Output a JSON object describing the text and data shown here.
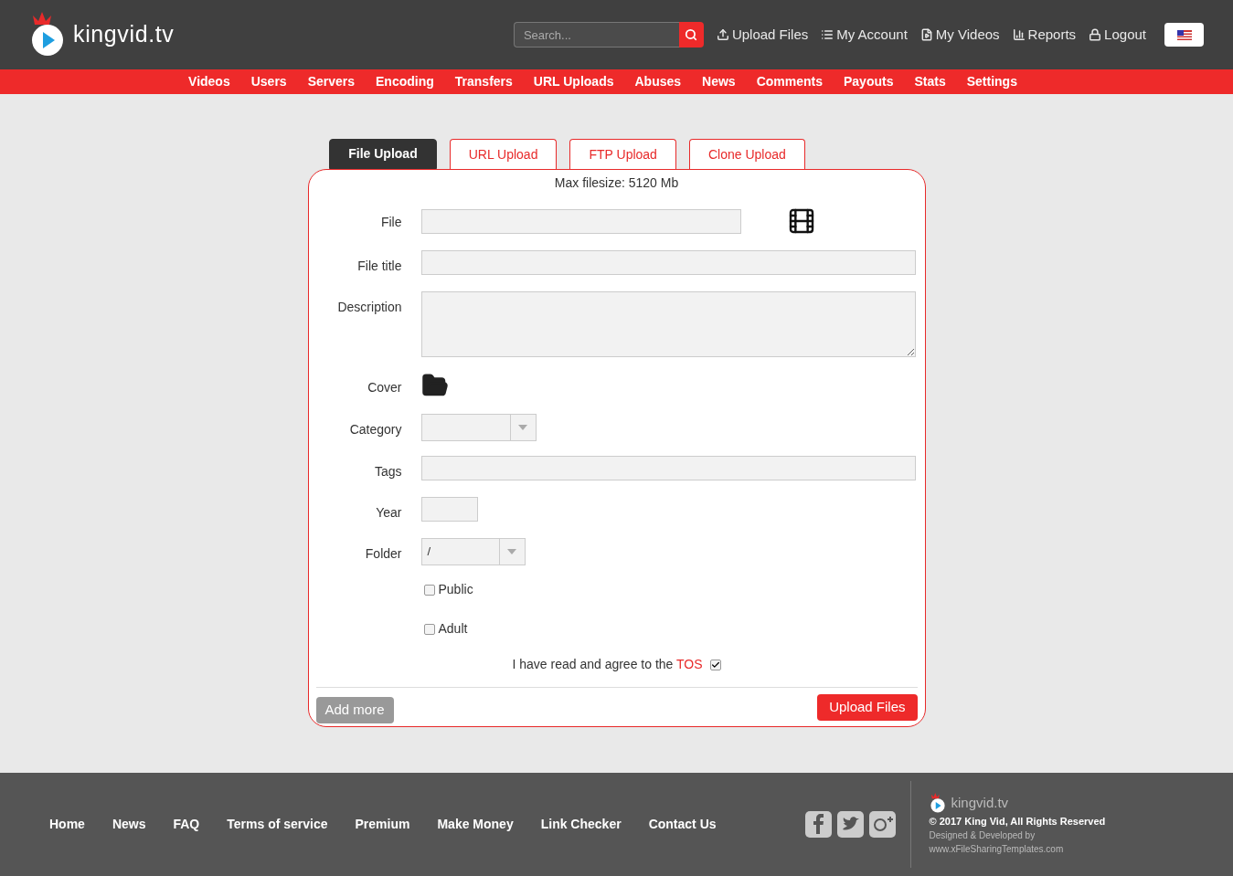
{
  "header": {
    "logo_text": "kingvid.tv",
    "search": {
      "placeholder": "Search..."
    },
    "user_menu": [
      {
        "kind": "upload",
        "label": "Upload Files"
      },
      {
        "kind": "account",
        "label": "My Account"
      },
      {
        "kind": "videos",
        "label": "My Videos"
      },
      {
        "kind": "reports",
        "label": "Reports"
      },
      {
        "kind": "logout",
        "label": "Logout"
      }
    ]
  },
  "nav": [
    "Videos",
    "Users",
    "Servers",
    "Encoding",
    "Transfers",
    "URL Uploads",
    "Abuses",
    "News",
    "Comments",
    "Payouts",
    "Stats",
    "Settings"
  ],
  "upload_tabs": [
    {
      "label": "File Upload",
      "selected": true
    },
    {
      "label": "URL Upload",
      "selected": false
    },
    {
      "label": "FTP Upload",
      "selected": false
    },
    {
      "label": "Clone Upload",
      "selected": false
    }
  ],
  "form": {
    "max_filesize": "Max filesize: 5120 Mb",
    "fields": [
      {
        "kind": "file",
        "label": "File"
      },
      {
        "kind": "text",
        "label": "File title"
      },
      {
        "kind": "textarea",
        "label": "Description"
      },
      {
        "kind": "cover",
        "label": "Cover"
      },
      {
        "kind": "select",
        "label": "Category"
      },
      {
        "kind": "text",
        "label": "Tags"
      },
      {
        "kind": "short",
        "label": "Year"
      },
      {
        "kind": "select",
        "label": "Folder",
        "value": "/"
      },
      {
        "kind": "checkbox",
        "label": "Public",
        "checked": false
      },
      {
        "kind": "checkbox",
        "label": "Adult",
        "checked": false
      }
    ],
    "tos": {
      "text": "I have read and agree to the",
      "link": "TOS",
      "checked": true
    },
    "add_more": "Add more",
    "submit": "Upload Files"
  },
  "footer": {
    "links": [
      "Home",
      "News",
      "FAQ",
      "Terms of service",
      "Premium",
      "Make Money",
      "Link Checker",
      "Contact Us"
    ],
    "social": [
      {
        "kind": "facebook"
      },
      {
        "kind": "twitter"
      },
      {
        "kind": "google-plus"
      }
    ],
    "brand": "kingvid.tv",
    "copyright": "© 2017 King Vid, All Rights Reserved",
    "designed": "Designed & Developed by",
    "site": "www.xFileSharingTemplates.com"
  }
}
